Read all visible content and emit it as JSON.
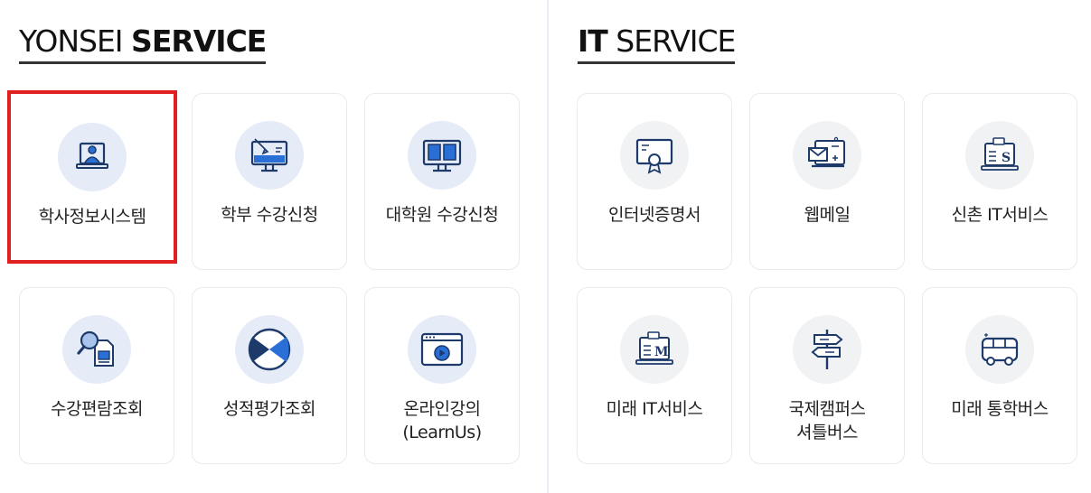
{
  "yonsei": {
    "title_light": "YONSEI ",
    "title_bold": "SERVICE",
    "cards": [
      {
        "label": [
          "학사정보시스템"
        ],
        "icon": "laptop-user-icon",
        "selected": true
      },
      {
        "label": [
          "학부 수강신청"
        ],
        "icon": "monitor-pen-icon"
      },
      {
        "label": [
          "대학원 수강신청"
        ],
        "icon": "monitor-book-icon"
      },
      {
        "label": [
          "수강편람조회"
        ],
        "icon": "magnifier-document-icon"
      },
      {
        "label": [
          "성적평가조회"
        ],
        "icon": "grade-evaluation-icon"
      },
      {
        "label": [
          "온라인강의",
          "(LearnUs)"
        ],
        "icon": "video-player-icon"
      }
    ]
  },
  "it": {
    "title_bold": "IT",
    "title_light": " SERVICE",
    "cards": [
      {
        "label": [
          "인터넷증명서"
        ],
        "icon": "certificate-icon"
      },
      {
        "label": [
          "웹메일"
        ],
        "icon": "mail-monitor-icon"
      },
      {
        "label": [
          "신촌 IT서비스"
        ],
        "icon": "laptop-s-icon"
      },
      {
        "label": [
          "미래 IT서비스"
        ],
        "icon": "laptop-m-icon"
      },
      {
        "label": [
          "국제캠퍼스",
          "셔틀버스"
        ],
        "icon": "signpost-icon"
      },
      {
        "label": [
          "미래 통학버스"
        ],
        "icon": "bus-icon"
      }
    ]
  },
  "colors": {
    "accent_blue": "#2a6fd6",
    "icon_navy": "#1d3a6b",
    "selected_border": "#e02020"
  }
}
